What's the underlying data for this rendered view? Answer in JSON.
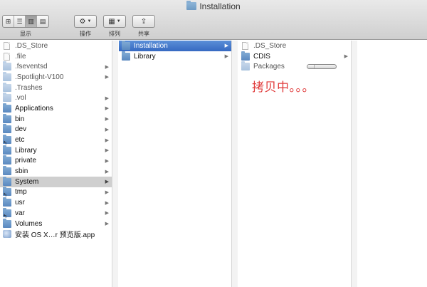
{
  "window": {
    "title": "Installation"
  },
  "toolbar": {
    "view_label": "显示",
    "action_label": "操作",
    "arrange_label": "排列",
    "share_label": "共享",
    "view_modes": [
      "icon-view",
      "list-view",
      "column-view",
      "coverflow-view"
    ],
    "active_view": "column-view"
  },
  "columns": {
    "root": [
      {
        "name": ".DS_Store",
        "icon": "document-icon",
        "arrow": false,
        "dim": true
      },
      {
        "name": ".file",
        "icon": "document-icon",
        "arrow": false,
        "dim": true
      },
      {
        "name": ".fseventsd",
        "icon": "folder-icon",
        "arrow": true,
        "dim": true
      },
      {
        "name": ".Spotlight-V100",
        "icon": "folder-icon",
        "arrow": true,
        "dim": true
      },
      {
        "name": ".Trashes",
        "icon": "folder-icon",
        "arrow": false,
        "dim": true
      },
      {
        "name": ".vol",
        "icon": "folder-icon",
        "arrow": true,
        "dim": true
      },
      {
        "name": "Applications",
        "icon": "folder-icon",
        "arrow": true,
        "dim": false
      },
      {
        "name": "bin",
        "icon": "folder-icon",
        "arrow": true,
        "dim": false
      },
      {
        "name": "dev",
        "icon": "folder-icon",
        "arrow": true,
        "dim": false
      },
      {
        "name": "etc",
        "icon": "alias-folder-icon",
        "arrow": true,
        "dim": false
      },
      {
        "name": "Library",
        "icon": "folder-icon",
        "arrow": true,
        "dim": false
      },
      {
        "name": "private",
        "icon": "folder-icon",
        "arrow": true,
        "dim": false
      },
      {
        "name": "sbin",
        "icon": "folder-icon",
        "arrow": true,
        "dim": false
      },
      {
        "name": "System",
        "icon": "folder-icon",
        "arrow": true,
        "dim": false,
        "selected": "gray"
      },
      {
        "name": "tmp",
        "icon": "alias-folder-icon",
        "arrow": true,
        "dim": false
      },
      {
        "name": "usr",
        "icon": "folder-icon",
        "arrow": true,
        "dim": false
      },
      {
        "name": "var",
        "icon": "alias-folder-icon",
        "arrow": true,
        "dim": false
      },
      {
        "name": "Volumes",
        "icon": "folder-icon",
        "arrow": true,
        "dim": false
      },
      {
        "name": "安装 OS X…r 预览版.app",
        "icon": "app-icon",
        "arrow": false,
        "dim": false
      }
    ],
    "system": [
      {
        "name": "Installation",
        "icon": "folder-icon",
        "arrow": true,
        "selected": "blue"
      },
      {
        "name": "Library",
        "icon": "folder-icon",
        "arrow": true
      }
    ],
    "installation": [
      {
        "name": ".DS_Store",
        "icon": "document-icon",
        "arrow": false,
        "dim": true
      },
      {
        "name": "CDIS",
        "icon": "folder-icon",
        "arrow": true,
        "dim": false
      },
      {
        "name": "Packages",
        "icon": "folder-icon",
        "arrow": false,
        "dim": true,
        "progress": 0.25
      }
    ]
  },
  "annotation": {
    "text": "拷贝中。。。",
    "color": "#e03a3a"
  },
  "colors": {
    "selection_blue": "#3669c1",
    "selection_gray": "#cfcfcf"
  }
}
